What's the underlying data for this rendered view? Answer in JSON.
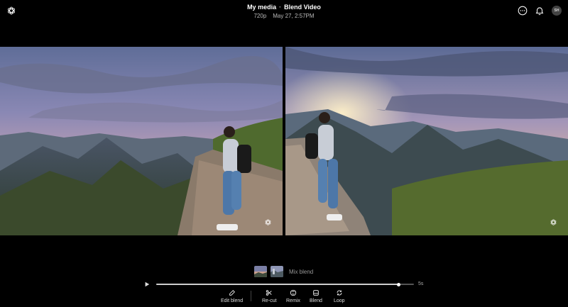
{
  "header": {
    "breadcrumb_root": "My media",
    "separator": "·",
    "title": "Blend Video",
    "resolution": "720p",
    "timestamp": "May 27, 2:57PM"
  },
  "top_icons": {
    "logo_icon": "openai-logo-icon",
    "more_icon": "more-options-icon",
    "notification_icon": "bell-icon",
    "avatar_initials": "SH"
  },
  "media": {
    "left_panel_icon": "sora-watermark-icon",
    "right_panel_icon": "sora-watermark-icon"
  },
  "blend": {
    "label": "Mix blend"
  },
  "player": {
    "duration": "5s",
    "progress": 0.94
  },
  "toolbar": {
    "edit_label": "Edit blend",
    "recut_label": "Re-cut",
    "remix_label": "Remix",
    "blend_label": "Blend",
    "loop_label": "Loop"
  },
  "colors": {
    "background": "#000000",
    "text_primary": "#ffffff",
    "text_secondary": "#bbbbbb",
    "track": "#555555"
  }
}
